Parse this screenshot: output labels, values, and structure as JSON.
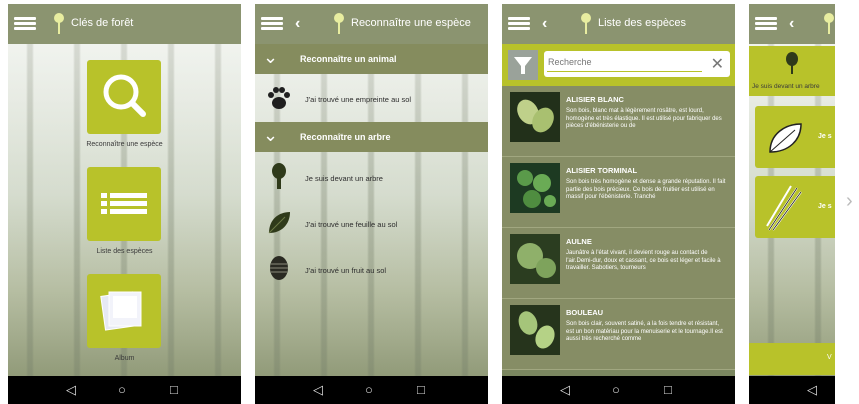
{
  "screen1": {
    "title": "Clés de forêt",
    "tiles": [
      {
        "label": "Reconnaître une espèce",
        "icon": "search-icon"
      },
      {
        "label": "Liste des espèces",
        "icon": "list-icon"
      },
      {
        "label": "Album",
        "icon": "album-icon"
      }
    ]
  },
  "screen2": {
    "title": "Reconnaître une espèce",
    "section_animal": "Reconnaître un animal",
    "animal_items": [
      {
        "label": "J'ai trouvé une empreinte au sol",
        "icon": "paw-icon"
      }
    ],
    "section_tree": "Reconnaître un arbre",
    "tree_items": [
      {
        "label": "Je suis devant un arbre",
        "icon": "tree-icon"
      },
      {
        "label": "J'ai trouvé une feuille au sol",
        "icon": "leaf-icon"
      },
      {
        "label": "J'ai trouvé un fruit au sol",
        "icon": "pinecone-icon"
      }
    ]
  },
  "screen3": {
    "title": "Liste des espèces",
    "search_placeholder": "Recherche",
    "species": [
      {
        "name": "ALISIER BLANC",
        "desc": "Son bois, blanc mat à légèrement rosâtre, est lourd, homogène et très élastique. Il est utilisé pour fabriquer des pièces d'ébénisterie ou de"
      },
      {
        "name": "ALISIER TORMINAL",
        "desc": "Son bois très homogène et dense a grande réputation. Il fait partie des bois précieux. Ce bois de fruitier est utilisé en massif pour l'ébénisterie. Tranché"
      },
      {
        "name": "AULNE",
        "desc": "Jaunâtre à l'état vivant, il devient rouge au contact de l'air.Demi-dur, doux et cassant, ce bois est léger et facile à travailler. Sabotiers, tourneurs"
      },
      {
        "name": "BOULEAU",
        "desc": "Son bois clair, souvent satiné, a la fois tendre et résistant, est un bon matériau pour la menuiserie et le tournage.Il est aussi très recherché comme"
      }
    ]
  },
  "screen4": {
    "subtitle": "Je suis devant un arbre",
    "cards": [
      {
        "label": "Je s",
        "icon": "leaf-outline-icon"
      },
      {
        "label": "Je s",
        "icon": "needles-icon"
      }
    ],
    "bottom_label": "V"
  },
  "navbar": {
    "back": "◁",
    "home": "○",
    "recent": "□"
  },
  "colors": {
    "accent": "#b8c22a",
    "bar": "#8b9470",
    "section": "#858c5e"
  }
}
